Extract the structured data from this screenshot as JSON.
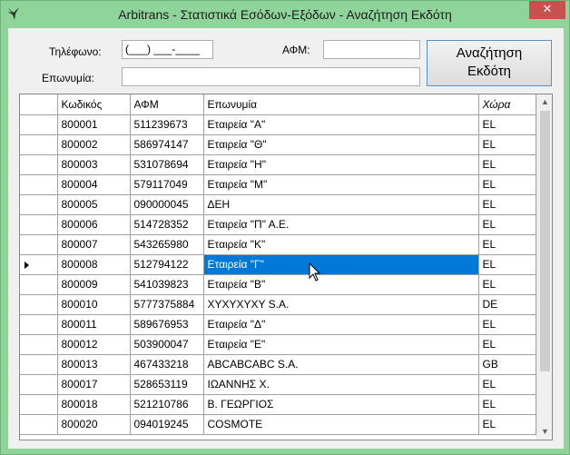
{
  "window": {
    "title": "Arbitrans - Στατιστικά Εσόδων-Εξόδων - Αναζήτηση Εκδότη",
    "close_glyph": "✕",
    "accent_color": "#8fd49a"
  },
  "form": {
    "phone_label": "Τηλέφωνο:",
    "phone_value": "(___) ___-____",
    "afm_label": "ΑΦΜ:",
    "afm_value": "",
    "surname_label": "Επωνυμία:",
    "surname_value": "",
    "search_button_line1": "Αναζήτηση",
    "search_button_line2": "Εκδότη"
  },
  "grid": {
    "columns": [
      "Κωδικός",
      "ΑΦΜ",
      "Επωνυμία",
      "Χώρα"
    ],
    "selected_row": 7,
    "selection_color": "#0078d7",
    "rows": [
      [
        "800001",
        "511239673",
        "Εταιρεία \"A\"",
        "EL"
      ],
      [
        "800002",
        "586974147",
        "Εταιρεία \"Θ\"",
        "EL"
      ],
      [
        "800003",
        "531078694",
        "Εταιρεία \"Η\"",
        "EL"
      ],
      [
        "800004",
        "579117049",
        "Εταιρεία \"Μ\"",
        "EL"
      ],
      [
        "800005",
        "090000045",
        "ΔΕΗ",
        "EL"
      ],
      [
        "800006",
        "514728352",
        "Εταιρεία \"Π\" Α.Ε.",
        "EL"
      ],
      [
        "800007",
        "543265980",
        "Εταιρεία \"Κ\"",
        "EL"
      ],
      [
        "800008",
        "512794122",
        "Εταιρεία \"Γ\"",
        "EL"
      ],
      [
        "800009",
        "541039823",
        "Εταιρεία \"Β\"",
        "EL"
      ],
      [
        "800010",
        "5777375884",
        "XYXYXYXY S.A.",
        "DE"
      ],
      [
        "800011",
        "589676953",
        "Εταιρεία \"Δ\"",
        "EL"
      ],
      [
        "800012",
        "503900047",
        "Εταιρεία \"Ε\"",
        "EL"
      ],
      [
        "800013",
        "467433218",
        "ABCABCABC S.A.",
        "GB"
      ],
      [
        "800017",
        "528653119",
        "ΙΩΑΝΝΗΣ Χ.",
        "EL"
      ],
      [
        "800018",
        "521210786",
        "Β. ΓΕΩΡΓΙΟΣ",
        "EL"
      ],
      [
        "800020",
        "094019245",
        "COSMOTE",
        "EL"
      ]
    ]
  }
}
